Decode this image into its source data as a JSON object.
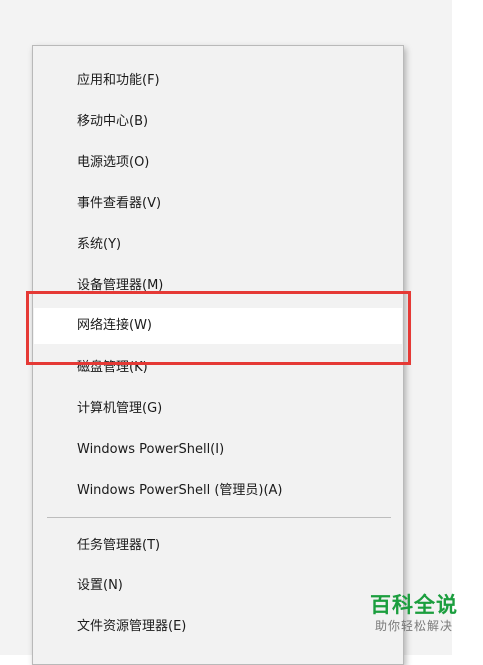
{
  "menu": {
    "items": [
      {
        "label": "应用和功能(F)"
      },
      {
        "label": "移动中心(B)"
      },
      {
        "label": "电源选项(O)"
      },
      {
        "label": "事件查看器(V)"
      },
      {
        "label": "系统(Y)"
      },
      {
        "label": "设备管理器(M)"
      },
      {
        "label": "网络连接(W)"
      },
      {
        "label": "磁盘管理(K)"
      },
      {
        "label": "计算机管理(G)"
      },
      {
        "label": "Windows PowerShell(I)"
      },
      {
        "label": "Windows PowerShell (管理员)(A)"
      },
      {
        "label": "任务管理器(T)"
      },
      {
        "label": "设置(N)"
      },
      {
        "label": "文件资源管理器(E)"
      }
    ]
  },
  "watermark": {
    "title": "百科全说",
    "subtitle": "助你轻松解决",
    "color": "#1b9e3e"
  },
  "annotation": {
    "color": "#e53935"
  }
}
